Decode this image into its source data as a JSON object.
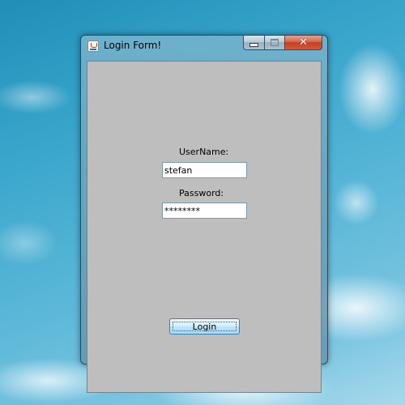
{
  "window": {
    "title": "Login Form!",
    "icon": "java-icon",
    "caption_buttons": {
      "minimize": "minimize-icon",
      "maximize": "maximize-icon",
      "close": "close-icon",
      "close_glyph": "✕"
    }
  },
  "form": {
    "username_label": "UserName:",
    "username_value": "stefan",
    "password_label": "Password:",
    "password_value": "********",
    "login_label": "Login"
  },
  "colors": {
    "client_background": "#bebebe",
    "close_button": "#c2401f",
    "button_border": "#3c7fb1"
  }
}
